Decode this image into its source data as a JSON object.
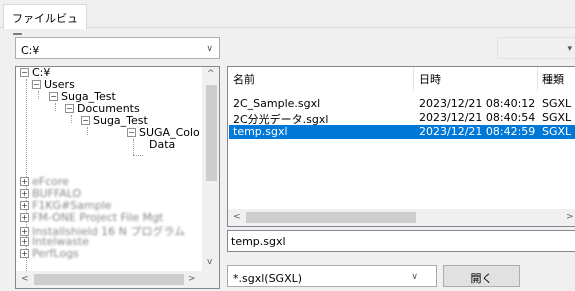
{
  "tab": {
    "label": "ファイルビュー"
  },
  "drive_combo": {
    "value": "C:¥",
    "arrow": "∨"
  },
  "right_combo": {
    "arrow": "▾"
  },
  "tree": {
    "root": "C:¥",
    "users": "Users",
    "suga_test": "Suga_Test",
    "documents": "Documents",
    "suga_test2": "Suga_Test",
    "suga_col": "SUGA_Colo",
    "data": "Data",
    "blurred": [
      "eFcore",
      "BUFFALO",
      "F1KG#Sample",
      "FM-ONE Project File Mgt",
      "Installshield 16 N プログラム",
      "Intelwaste",
      "PerfLogs"
    ]
  },
  "list": {
    "columns": [
      "名前",
      "日時",
      "種類"
    ],
    "rows": [
      {
        "name": "2C_Sample.sgxl",
        "date": "2023/12/21 08:40:12",
        "type": "SGXL",
        "selected": false
      },
      {
        "name": "2C分光データ.sgxl",
        "date": "2023/12/21 08:40:54",
        "type": "SGXL",
        "selected": false
      },
      {
        "name": "temp.sgxl",
        "date": "2023/12/21 08:42:59",
        "type": "SGXL",
        "selected": true
      }
    ]
  },
  "filename": {
    "value": "temp.sgxl"
  },
  "filetype": {
    "value": "*.sgxl(SGXL)",
    "arrow": "∨"
  },
  "open_button": {
    "label": "開く"
  },
  "scroll": {
    "up": "^",
    "down": "v",
    "left": "<",
    "right": ">"
  }
}
